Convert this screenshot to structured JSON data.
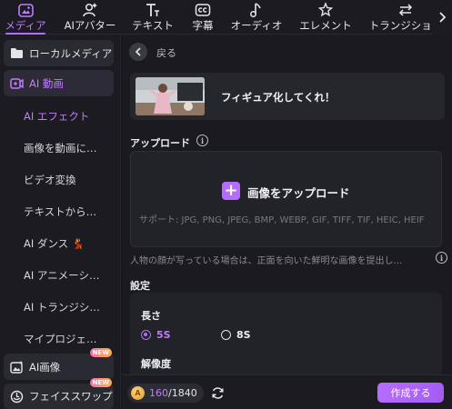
{
  "toolbar": {
    "items": [
      {
        "label": "メディア",
        "icon": "media-icon",
        "active": true
      },
      {
        "label": "AIアバター",
        "icon": "avatar-icon"
      },
      {
        "label": "テキスト",
        "icon": "text-icon"
      },
      {
        "label": "字幕",
        "icon": "caption-icon"
      },
      {
        "label": "オーディオ",
        "icon": "audio-icon"
      },
      {
        "label": "エレメント",
        "icon": "element-icon"
      },
      {
        "label": "トランジション",
        "icon": "transition-icon"
      }
    ],
    "next_icon": "chevron-right-icon"
  },
  "sidebar": {
    "local_media": "ローカルメディア",
    "ai_video": "AI 動画",
    "sub_items": [
      "AI エフェクト",
      "画像を動画に…",
      "ビデオ変換",
      "テキストから…",
      "AI ダンス",
      "AI アニメーシ…",
      "AI トランジシ…",
      "マイプロジェ…"
    ],
    "ai_image": "AI画像",
    "face_swap": "フェイススワップ",
    "new_badge": "NEW"
  },
  "main": {
    "back_label": "戻る",
    "effect_title": "フィギュア化してくれ！",
    "upload_section": "アップロード",
    "upload_button": "画像をアップロード",
    "upload_support": "サポート: JPG, PNG, JPEG, BMP, WEBP, GIF, TIFF, TIF, HEIC, HEIF",
    "note": "人物の顔が写っている場合は、正面を向いた鮮明な画像を提出し…",
    "settings_title": "設定",
    "length_label": "長さ",
    "length_options": [
      "5S",
      "8S"
    ],
    "length_selected": "5S",
    "resolution_label": "解像度"
  },
  "footer": {
    "credits_used": "160",
    "credits_total": "/1840",
    "create_button": "作成する"
  },
  "colors": {
    "accent": "#b46cff",
    "background": "#17171c",
    "panel": "#222229"
  }
}
